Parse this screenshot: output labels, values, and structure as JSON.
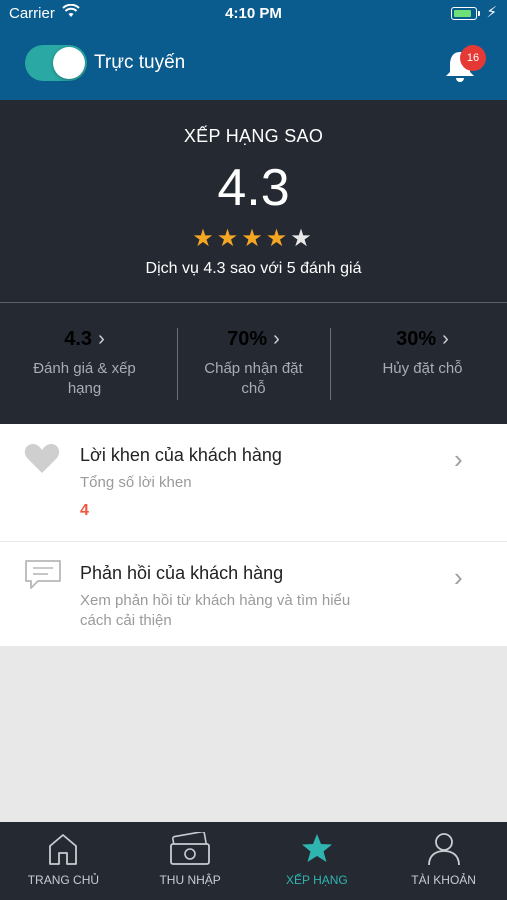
{
  "status_bar": {
    "carrier": "Carrier",
    "time": "4:10 PM"
  },
  "header": {
    "online_label": "Trực tuyến",
    "online": true,
    "notification_count": "16"
  },
  "rating": {
    "title": "XẾP HẠNG SAO",
    "score": "4.3",
    "stars_filled": 4,
    "stars_total": 5,
    "summary": "Dịch vụ 4.3 sao với 5 đánh giá",
    "stats": [
      {
        "value": "4.3",
        "label": "Đánh giá & xếp hạng"
      },
      {
        "value": "70%",
        "label": "Chấp nhận đặt chỗ"
      },
      {
        "value": "30%",
        "label": "Hủy đặt chỗ"
      }
    ]
  },
  "compliments": {
    "title": "Lời khen của khách hàng",
    "subtitle": "Tổng số lời khen",
    "count": "4"
  },
  "feedback": {
    "title": "Phản hồi của khách hàng",
    "subtitle": "Xem phản hồi từ khách hàng và tìm hiểu cách cải thiện"
  },
  "tabs": [
    {
      "label": "TRANG CHỦ",
      "icon": "home-icon"
    },
    {
      "label": "THU NHẬP",
      "icon": "wallet-icon"
    },
    {
      "label": "XẾP HẠNG",
      "icon": "star-icon",
      "active": true
    },
    {
      "label": "TÀI KHOẢN",
      "icon": "user-icon"
    }
  ],
  "colors": {
    "header_bg": "#0b5c8e",
    "panel_bg": "#252932",
    "accent": "#2fb4b0",
    "star": "#f5a623",
    "badge": "#e53935",
    "count": "#f0573c"
  }
}
